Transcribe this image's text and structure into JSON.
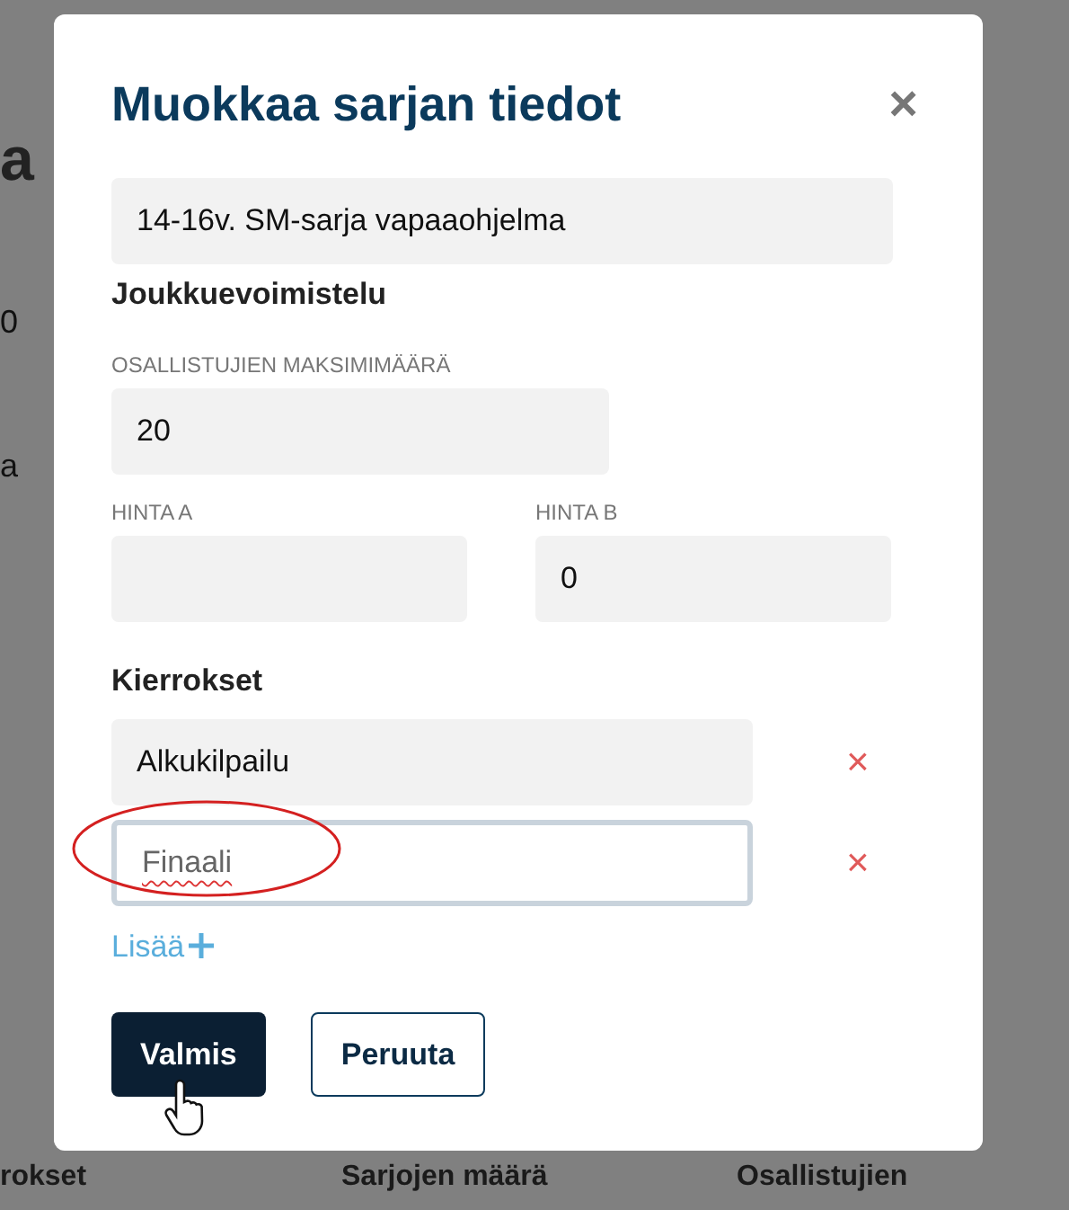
{
  "background": {
    "side_fragments": [
      {
        "text": "a",
        "kind": "heading"
      },
      {
        "text": "0",
        "kind": "value"
      },
      {
        "text": "a",
        "kind": "value"
      }
    ],
    "bottom_columns": [
      "rokset",
      "Sarjojen määrä",
      "Osallistujien"
    ]
  },
  "dialog": {
    "title": "Muokkaa sarjan tiedot",
    "close": "×",
    "name_value": "14-16v. SM-sarja vapaaohjelma",
    "discipline": "Joukkuevoimistelu",
    "max_label": "OSALLISTUJIEN MAKSIMIMÄÄRÄ",
    "max_value": "20",
    "prices": [
      {
        "label": "HINTA A"
      },
      {
        "label": "HINTA B",
        "value": "0"
      }
    ],
    "rounds_label": "Kierrokset",
    "rounds": [
      {
        "value": "Alkukilpailu",
        "focused": false,
        "remove": "×"
      },
      {
        "value": "Finaali",
        "focused": true,
        "remove": "×"
      }
    ],
    "add_label": "Lisää",
    "buttons": [
      {
        "label": "Valmis",
        "kind": "primary"
      },
      {
        "label": "Peruuta",
        "kind": "secondary"
      }
    ]
  }
}
